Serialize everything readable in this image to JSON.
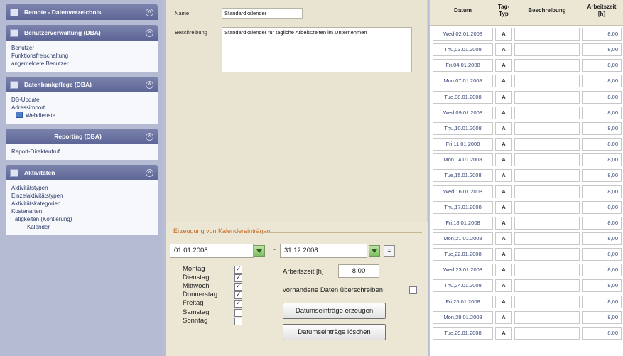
{
  "sidebar": {
    "panels": [
      {
        "title": "Remote - Datenverzeichnis",
        "items": []
      },
      {
        "title": "Benutzerverwaltung (DBA)",
        "items": [
          "Benutzer",
          "Funktionsfreischaltung",
          "angemeldete Benutzer"
        ]
      },
      {
        "title": "Datenbankpflege (DBA)",
        "items": [
          "DB-Update",
          "Adressimport",
          "Webdienste"
        ]
      },
      {
        "title": "Reporting (DBA)",
        "items": [
          "Report-Direktaufruf"
        ]
      },
      {
        "title": "Aktivitäten",
        "items": [
          "Aktivitätstypen",
          "Einzelaktivitätstypen",
          "Aktivitätskategorien",
          "Kostenarten",
          "Tätigkeiten (Kontierung)",
          "Kalender"
        ]
      }
    ]
  },
  "form": {
    "name_label": "Name",
    "name_value": "Standardkalender",
    "desc_label": "Beschreibung",
    "desc_value": "Standardkalender für tägliche Arbeitszeiten im Unternehmen"
  },
  "generation": {
    "title": "Erzeugung von Kalendereinträgen",
    "from_date": "01.01.2008",
    "separator": "-",
    "to_date": "31.12.2008",
    "eq_label": "=",
    "days": [
      {
        "label": "Montag",
        "checked": true
      },
      {
        "label": "Dienstag",
        "checked": true
      },
      {
        "label": "Mittwoch",
        "checked": true
      },
      {
        "label": "Donnerstag",
        "checked": true
      },
      {
        "label": "Freitag",
        "checked": true
      },
      {
        "label": "Samstag",
        "checked": false
      },
      {
        "label": "Sonntag",
        "checked": false
      }
    ],
    "worktime_label": "Arbeitszeit [h]",
    "worktime_value": "8,00",
    "overwrite_label": "vorhandene Daten überschreiben",
    "overwrite_checked": false,
    "create_button": "Datumseinträge erzeugen",
    "delete_button": "Datumseinträge löschen"
  },
  "table": {
    "headers": {
      "datum": "Datum",
      "tagtyp": "Tag-\nTyp",
      "beschreibung": "Beschreibung",
      "arbeitszeit": "Arbeitszeit\n[h]"
    },
    "rows": [
      {
        "date": "Wed,02.01.2008",
        "typ": "A",
        "desc": "",
        "hours": "8,00"
      },
      {
        "date": "Thu,03.01.2008",
        "typ": "A",
        "desc": "",
        "hours": "8,00"
      },
      {
        "date": "Fri,04.01.2008",
        "typ": "A",
        "desc": "",
        "hours": "8,00"
      },
      {
        "date": "Mon,07.01.2008",
        "typ": "A",
        "desc": "",
        "hours": "8,00"
      },
      {
        "date": "Tue,08.01.2008",
        "typ": "A",
        "desc": "",
        "hours": "8,00"
      },
      {
        "date": "Wed,09.01.2008",
        "typ": "A",
        "desc": "",
        "hours": "8,00"
      },
      {
        "date": "Thu,10.01.2008",
        "typ": "A",
        "desc": "",
        "hours": "8,00"
      },
      {
        "date": "Fri,11.01.2008",
        "typ": "A",
        "desc": "",
        "hours": "8,00"
      },
      {
        "date": "Mon,14.01.2008",
        "typ": "A",
        "desc": "",
        "hours": "8,00"
      },
      {
        "date": "Tue,15.01.2008",
        "typ": "A",
        "desc": "",
        "hours": "8,00"
      },
      {
        "date": "Wed,16.01.2008",
        "typ": "A",
        "desc": "",
        "hours": "8,00"
      },
      {
        "date": "Thu,17.01.2008",
        "typ": "A",
        "desc": "",
        "hours": "8,00"
      },
      {
        "date": "Fri,18.01.2008",
        "typ": "A",
        "desc": "",
        "hours": "8,00"
      },
      {
        "date": "Mon,21.01.2008",
        "typ": "A",
        "desc": "",
        "hours": "8,00"
      },
      {
        "date": "Tue,22.01.2008",
        "typ": "A",
        "desc": "",
        "hours": "8,00"
      },
      {
        "date": "Wed,23.01.2008",
        "typ": "A",
        "desc": "",
        "hours": "8,00"
      },
      {
        "date": "Thu,24.01.2008",
        "typ": "A",
        "desc": "",
        "hours": "8,00"
      },
      {
        "date": "Fri,25.01.2008",
        "typ": "A",
        "desc": "",
        "hours": "8,00"
      },
      {
        "date": "Mon,28.01.2008",
        "typ": "A",
        "desc": "",
        "hours": "8,00"
      },
      {
        "date": "Tue,29.01.2008",
        "typ": "A",
        "desc": "",
        "hours": "8,00"
      }
    ]
  }
}
